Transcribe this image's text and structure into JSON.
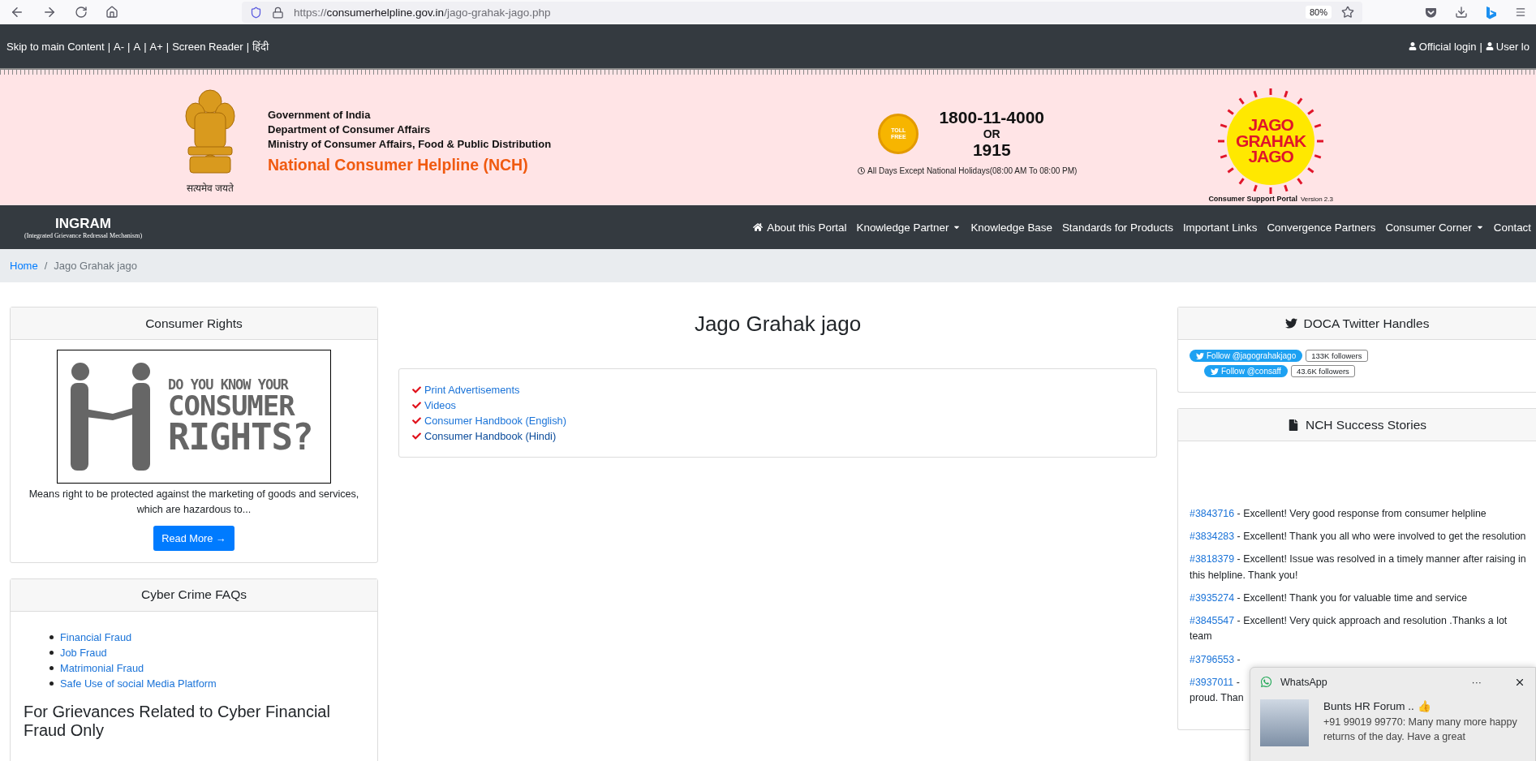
{
  "browser": {
    "url": {
      "scheme": "https://",
      "host": "consumerhelpline.gov.in",
      "path": "/jago-grahak-jago.php"
    },
    "zoom": "80%"
  },
  "top_bar": {
    "links": [
      "Skip to main Content",
      "A-",
      "A",
      "A+",
      "Screen Reader",
      "हिंदी"
    ],
    "separator": "|",
    "logins": [
      "Official login",
      "User lo"
    ]
  },
  "header": {
    "motto": "सत्यमेव जयते",
    "lines": [
      "Government of India",
      "Department of Consumer Affairs",
      "Ministry of Consumer Affairs, Food & Public Distribution"
    ],
    "title": "National Consumer Helpline (NCH)",
    "toll_free": "TOLL FREE",
    "phone_primary": "1800-11-4000",
    "or": "OR",
    "phone_short": "1915",
    "hours": "All Days Except National Holidays(08:00 AM To 08:00 PM)",
    "logo_lines": [
      "JAGO",
      "GRAHAK",
      "JAGO"
    ],
    "portal": "Consumer Support Portal",
    "version": "Version 2.3"
  },
  "nav": {
    "brand": "INGRAM",
    "brand_sub": "(Integrated Grievance Redressal Mechanism)",
    "items": [
      {
        "label": "About this Portal",
        "kind": "home"
      },
      {
        "label": "Knowledge Partner",
        "kind": "dropdown"
      },
      {
        "label": "Knowledge Base",
        "kind": "link"
      },
      {
        "label": "Standards for Products",
        "kind": "link"
      },
      {
        "label": "Important Links",
        "kind": "link"
      },
      {
        "label": "Convergence Partners",
        "kind": "link"
      },
      {
        "label": "Consumer Corner",
        "kind": "dropdown"
      },
      {
        "label": "Contact",
        "kind": "link"
      }
    ]
  },
  "breadcrumb": {
    "items": [
      "Home",
      "Jago Grahak jago"
    ],
    "separator": "/"
  },
  "consumer_rights": {
    "title": "Consumer Rights",
    "poster_lines": [
      "DO YOU KNOW YOUR",
      "CONSUMER",
      "RIGHTS?"
    ],
    "description": "Means right to be protected against the marketing of goods and services, which are hazardous to...",
    "button": "Read More →"
  },
  "cyber_crime": {
    "title": "Cyber Crime FAQs",
    "links": [
      "Financial Fraud",
      "Job Fraud",
      "Matrimonial Fraud",
      "Safe Use of social Media Platform"
    ],
    "heading": "For Grievances Related to Cyber Financial Fraud Only"
  },
  "main": {
    "title": "Jago Grahak jago",
    "links": [
      {
        "label": "Print Advertisements",
        "visited": false
      },
      {
        "label": "Videos",
        "visited": false
      },
      {
        "label": "Consumer Handbook (English)",
        "visited": false
      },
      {
        "label": "Consumer Handbook (Hindi)",
        "visited": true
      }
    ]
  },
  "twitter": {
    "title": "DOCA Twitter Handles",
    "handles": [
      {
        "button": "Follow @jagograhakjago",
        "count": "133K followers"
      },
      {
        "button": "Follow @consaff",
        "count": "43.6K followers"
      }
    ]
  },
  "stories": {
    "title": "NCH Success Stories",
    "items": [
      {
        "id": "#3843716",
        "text": "- Excellent! Very good response from consumer helpline"
      },
      {
        "id": "#3834283",
        "text": "- Excellent! Thank you all who were involved to get the resolution"
      },
      {
        "id": "#3818379",
        "text": "- Excellent! Issue was resolved in a timely manner after raising in this helpline. Thank you!"
      },
      {
        "id": "#3935274",
        "text": "- Excellent! Thank you for valuable time and service"
      },
      {
        "id": "#3845547",
        "text": "- Excellent! Very quick approach and resolution .Thanks a lot team"
      },
      {
        "id": "#3796553",
        "text": "-"
      },
      {
        "id": "#3937011",
        "text": "-",
        "continuation": "proud. Than"
      }
    ]
  },
  "notification": {
    "app": "WhatsApp",
    "menu": "···",
    "title": "Bunts HR Forum .. 👍",
    "message": "+91 99019 99770: Many many more happy returns of the day.  Have a great"
  }
}
